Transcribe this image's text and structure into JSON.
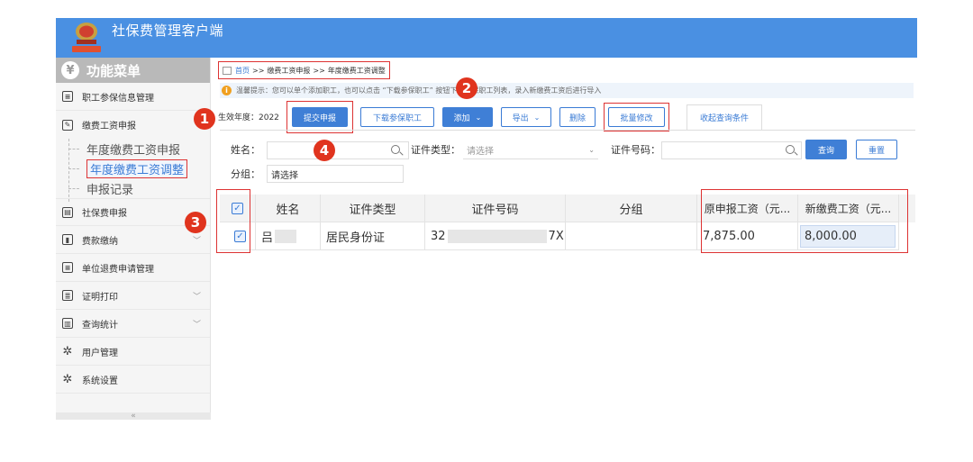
{
  "header": {
    "app_title": "社保费管理客户端"
  },
  "sidebar": {
    "menu_title": "功能菜单",
    "yen_symbol": "¥",
    "items": [
      {
        "label": "职工参保信息管理",
        "icon": "list-icon"
      },
      {
        "label": "缴费工资申报",
        "icon": "edit-icon"
      },
      {
        "label": "社保费申报",
        "icon": "doc-icon"
      },
      {
        "label": "费款缴纳",
        "icon": "book-icon"
      },
      {
        "label": "单位退费申请管理",
        "icon": "list-icon"
      },
      {
        "label": "证明打印",
        "icon": "print-icon"
      },
      {
        "label": "查询统计",
        "icon": "chart-icon"
      },
      {
        "label": "用户管理",
        "icon": "gear-icon"
      },
      {
        "label": "系统设置",
        "icon": "gear-icon"
      }
    ],
    "subitems": [
      "年度缴费工资申报",
      "年度缴费工资调整",
      "申报记录"
    ],
    "collapse_glyph": "«"
  },
  "breadcrumb": {
    "home": "首页",
    "sep1": ">>",
    "level2": "缴费工资申报",
    "sep2": ">>",
    "level3": "年度缴费工资调整"
  },
  "tip": {
    "icon": "i",
    "text": "温馨提示：您可以单个添加职工，也可以点击 “下载参保职工” 按钮下载参保职工列表，录入新缴费工资后进行导入"
  },
  "toolbar": {
    "year_label": "生效年度：2022",
    "submit": "提交申报",
    "download": "下载参保职工",
    "add": "添加",
    "export": "导出",
    "delete": "删除",
    "batch_edit": "批量修改",
    "collapse_query": "收起查询条件",
    "caret": "⌄"
  },
  "filters": {
    "name_label": "姓名：",
    "idtype_label": "证件类型：",
    "idtype_placeholder": "请选择",
    "idnum_label": "证件号码：",
    "group_label": "分组：",
    "group_value": "请选择",
    "query": "查询",
    "reset": "重置"
  },
  "table": {
    "headers": [
      "姓名",
      "证件类型",
      "证件号码",
      "分组",
      "原申报工资（元...",
      "新缴费工资（元..."
    ],
    "row": {
      "name_first": "吕",
      "id_type": "居民身份证",
      "id_prefix": "32",
      "id_suffix": "7X",
      "group": "",
      "orig_salary": "7,875.00",
      "new_salary": "8,000.00"
    },
    "check": "✓"
  },
  "annotations": [
    "1",
    "2",
    "3",
    "4"
  ],
  "colors": {
    "header": "#4a90e2",
    "primary": "#3f7fd6",
    "annotation": "#e0341e",
    "highlight_box": "#dd3333"
  }
}
